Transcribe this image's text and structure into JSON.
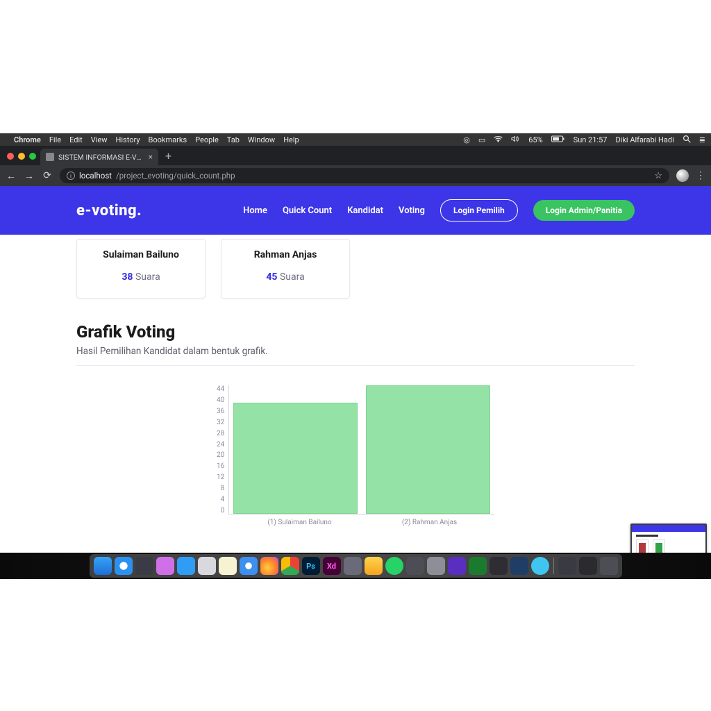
{
  "menubar": {
    "app": "Chrome",
    "items": [
      "File",
      "Edit",
      "View",
      "History",
      "Bookmarks",
      "People",
      "Tab",
      "Window",
      "Help"
    ],
    "battery": "65%",
    "datetime": "Sun 21:57",
    "user": "Diki Alfarabi Hadi"
  },
  "tab": {
    "title": "SISTEM INFORMASI E-VOTING |"
  },
  "omnibox": {
    "host": "localhost",
    "path": "/project_evoting/quick_count.php"
  },
  "nav": {
    "brand": "e-voting.",
    "links": [
      "Home",
      "Quick Count",
      "Kandidat",
      "Voting"
    ],
    "login_pemilih": "Login Pemilih",
    "login_admin": "Login Admin/Panitia"
  },
  "cards": [
    {
      "name": "Sulaiman Bailuno",
      "votes": 38,
      "suffix": "Suara"
    },
    {
      "name": "Rahman Anjas",
      "votes": 45,
      "suffix": "Suara"
    }
  ],
  "section": {
    "title": "Grafik Voting",
    "subtitle": "Hasil Pemilihan Kandidat dalam bentuk grafik."
  },
  "chart_data": {
    "type": "bar",
    "categories": [
      "(1) Sulaiman Bailuno",
      "(2) Rahman Anjas"
    ],
    "values": [
      38,
      45
    ],
    "title": "",
    "xlabel": "",
    "ylabel": "",
    "ylim": [
      0,
      44
    ],
    "yticks": [
      0,
      4,
      8,
      12,
      16,
      20,
      24,
      28,
      32,
      36,
      40,
      44
    ]
  }
}
